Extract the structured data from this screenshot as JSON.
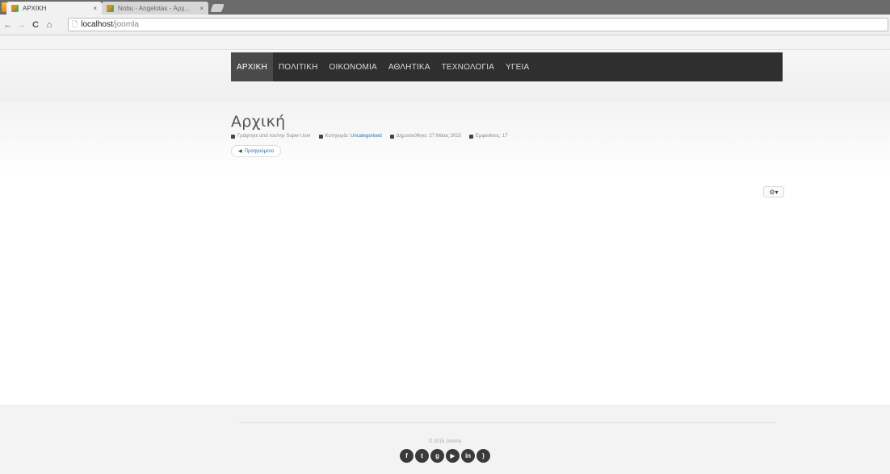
{
  "browser": {
    "tabs": [
      {
        "title": "ΑΡΧΙΚΗ",
        "active": true
      },
      {
        "title": "Nobu - Angelotas - Αρχ...",
        "active": false
      }
    ],
    "nav": {
      "back": "←",
      "forward": "→",
      "reload": "C",
      "home": "⌂"
    },
    "address": {
      "host": "localhost",
      "path": "/joomla"
    }
  },
  "site": {
    "menu": [
      "ΑΡΧΙΚΗ",
      "ΠΟΛΙΤΙΚΗ",
      "ΟΙΚΟΝΟΜΙΑ",
      "ΑΘΛΗΤΙΚΑ",
      "ΤΕΧΝΟΛΟΓΙΑ",
      "ΥΓΕΙΑ"
    ],
    "active_menu_index": 0,
    "article": {
      "title": "Αρχική",
      "meta": {
        "author": "Γράφτηκε από τον/την Super User",
        "category_label": "Κατηγορία:",
        "category_value": "Uncategorised",
        "published": "Δημοσιεύθηκε: 27 Μάιος 2015",
        "hits": "Εμφανίσεις: 17"
      },
      "prev_button": "Προηγούμενο",
      "tools_button": "⚙▾"
    },
    "footer": {
      "copyright": "© 2015 Joomla",
      "social_icons": [
        "facebook-icon",
        "twitter-icon",
        "google-plus-icon",
        "youtube-icon",
        "linkedin-icon",
        "rss-icon"
      ]
    }
  },
  "colors": {
    "nav_bg": "#2f2f2f",
    "nav_active_bg": "#4a4a4a",
    "link": "#2a6db0"
  }
}
